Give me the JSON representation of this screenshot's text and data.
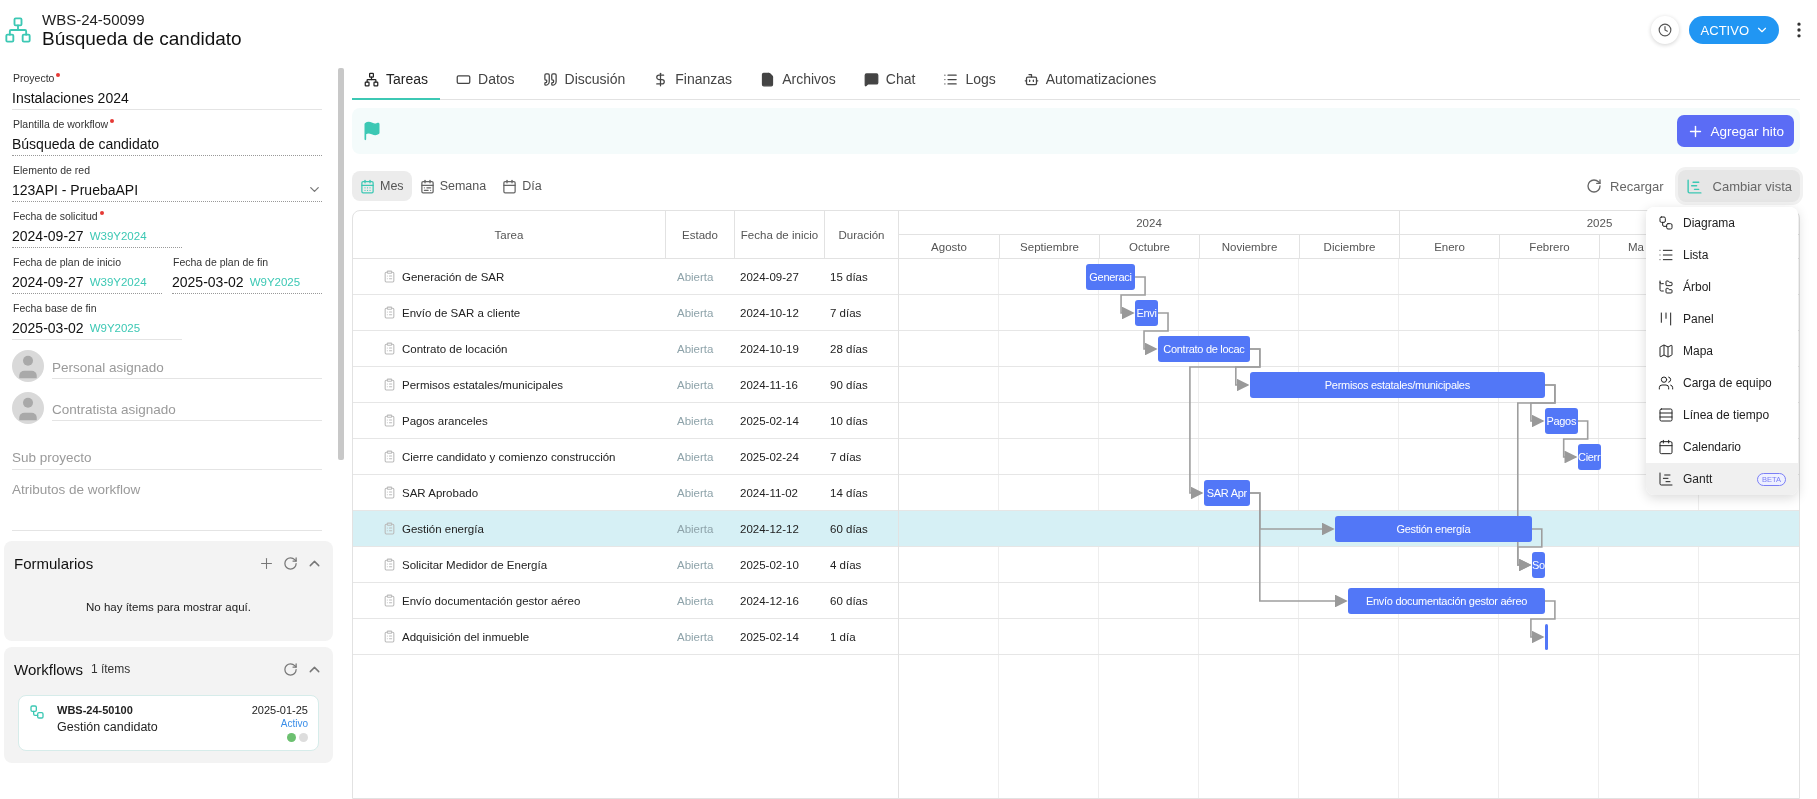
{
  "header": {
    "code": "WBS-24-50099",
    "title": "Búsqueda de candidato",
    "status": "ACTIVO"
  },
  "field_rows": [
    [
      {
        "label": "Proyecto",
        "required": true,
        "value": "Instalaciones 2024",
        "kind": "text",
        "editable": false
      }
    ],
    [
      {
        "label": "Plantilla de workflow",
        "required": true,
        "value": "Búsqueda de candidato",
        "kind": "text",
        "editable": true
      }
    ],
    [
      {
        "label": "Elemento de red",
        "required": false,
        "value": "123API - PruebaAPI",
        "kind": "select",
        "editable": true
      }
    ],
    [
      {
        "label": "Fecha de solicitud",
        "required": true,
        "value": "2024-09-27",
        "week": "W39Y2024",
        "kind": "date",
        "editable": true
      }
    ],
    [
      {
        "label": "Fecha de plan de inicio",
        "required": false,
        "value": "2024-09-27",
        "week": "W39Y2024",
        "kind": "date",
        "editable": true
      },
      {
        "label": "Fecha de plan de fin",
        "required": false,
        "value": "2025-03-02",
        "week": "W9Y2025",
        "kind": "date",
        "editable": true
      }
    ],
    [
      {
        "label": "Fecha base de fin",
        "required": false,
        "value": "2025-03-02",
        "week": "W9Y2025",
        "kind": "date",
        "editable": false
      }
    ]
  ],
  "assignees": [
    {
      "placeholder": "Personal asignado"
    },
    {
      "placeholder": "Contratista asignado"
    }
  ],
  "extra_fields": [
    {
      "placeholder": "Sub proyecto"
    },
    {
      "placeholder": "Atributos de workflow"
    }
  ],
  "forms_card": {
    "title": "Formularios",
    "empty_text": "No hay ítems para mostrar aquí."
  },
  "workflows_card": {
    "title": "Workflows",
    "count": "1 ítems",
    "items": [
      {
        "code": "WBS-24-50100",
        "name": "Gestión candidato",
        "date": "2025-01-25",
        "status": "Activo",
        "dots": [
          {
            "color": "#6cc070"
          },
          {
            "color": "#dddddd"
          }
        ]
      }
    ]
  },
  "tabs": [
    {
      "label": "Tareas",
      "selected": true
    },
    {
      "label": "Datos",
      "selected": false
    },
    {
      "label": "Discusión",
      "selected": false
    },
    {
      "label": "Finanzas",
      "selected": false
    },
    {
      "label": "Archivos",
      "selected": false
    },
    {
      "label": "Chat",
      "selected": false
    },
    {
      "label": "Logs",
      "selected": false
    },
    {
      "label": "Automatizaciones",
      "selected": false
    }
  ],
  "milestones": {
    "add_button": "Agregar hito"
  },
  "view_modes": [
    {
      "label": "Mes",
      "selected": true
    },
    {
      "label": "Semana",
      "selected": false
    },
    {
      "label": "Día",
      "selected": false
    }
  ],
  "reload_button": "Recargar",
  "change_view_button": {
    "label": "Cambiar vista",
    "expanded": true
  },
  "view_menu": [
    {
      "label": "Diagrama",
      "selected": false
    },
    {
      "label": "Lista",
      "selected": false
    },
    {
      "label": "Árbol",
      "selected": false
    },
    {
      "label": "Panel",
      "selected": false
    },
    {
      "label": "Mapa",
      "selected": false
    },
    {
      "label": "Carga de equipo",
      "selected": false
    },
    {
      "label": "Línea de tiempo",
      "selected": false
    },
    {
      "label": "Calendario",
      "selected": false
    },
    {
      "label": "Gantt",
      "selected": true,
      "badge": "BETA"
    }
  ],
  "table": {
    "columns": [
      "Tarea",
      "Estado",
      "Fecha de inicio",
      "Duración"
    ],
    "years": [
      {
        "label": "2024",
        "months": [
          "Agosto",
          "Septiembre",
          "Octubre",
          "Noviembre",
          "Diciembre"
        ]
      },
      {
        "label": "2025",
        "months": [
          "Enero",
          "Febrero",
          "Ma"
        ]
      }
    ],
    "rows": [
      {
        "task": "Generación de SAR",
        "status": "Abierta",
        "start": "2024-09-27",
        "duration": "15 días",
        "bar_label": "Generaci",
        "selected": false
      },
      {
        "task": "Envío de SAR a cliente",
        "status": "Abierta",
        "start": "2024-10-12",
        "duration": "7 días",
        "bar_label": "Envi",
        "selected": false
      },
      {
        "task": "Contrato de locación",
        "status": "Abierta",
        "start": "2024-10-19",
        "duration": "28 días",
        "bar_label": "Contrato de locac",
        "selected": false
      },
      {
        "task": "Permisos estatales/municipales",
        "status": "Abierta",
        "start": "2024-11-16",
        "duration": "90 días",
        "bar_label": "Permisos estatales/municipales",
        "selected": false
      },
      {
        "task": "Pagos aranceles",
        "status": "Abierta",
        "start": "2025-02-14",
        "duration": "10 días",
        "bar_label": "Pagos",
        "selected": false
      },
      {
        "task": "Cierre candidato y comienzo construcción",
        "status": "Abierta",
        "start": "2025-02-24",
        "duration": "7 días",
        "bar_label": "Cierr",
        "selected": false
      },
      {
        "task": "SAR Aprobado",
        "status": "Abierta",
        "start": "2024-11-02",
        "duration": "14 días",
        "bar_label": "SAR Apr",
        "selected": false
      },
      {
        "task": "Gestión energía",
        "status": "Abierta",
        "start": "2024-12-12",
        "duration": "60 días",
        "bar_label": "Gestión energía",
        "selected": true
      },
      {
        "task": "Solicitar Medidor de Energía",
        "status": "Abierta",
        "start": "2025-02-10",
        "duration": "4 días",
        "bar_label": "So",
        "selected": false
      },
      {
        "task": "Envío documentación gestor aéreo",
        "status": "Abierta",
        "start": "2024-12-16",
        "duration": "60 días",
        "bar_label": "Envío documentación gestor aéreo",
        "selected": false
      },
      {
        "task": "Adquisición del inmueble",
        "status": "Abierta",
        "start": "2025-02-14",
        "duration": "1 día",
        "selected": false
      }
    ]
  }
}
